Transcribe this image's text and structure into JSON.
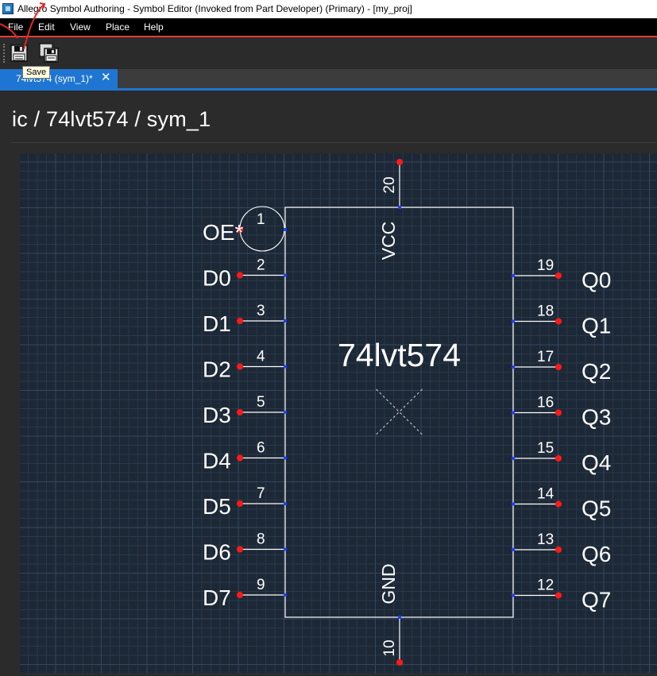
{
  "window": {
    "title": "Allegro Symbol Authoring - Symbol Editor (Invoked from Part Developer) (Primary) - [my_proj]"
  },
  "menu": [
    "File",
    "Edit",
    "View",
    "Place",
    "Help"
  ],
  "toolbar": {
    "save_tooltip": "Save",
    "save_icon": "save-icon",
    "save_all_icon": "save-all-icon"
  },
  "tab": {
    "label": "74lvt574 (sym_1)*",
    "close": "✕"
  },
  "breadcrumb": "ic / 74lvt574 / sym_1",
  "symbol": {
    "part_name": "74lvt574",
    "left_pins": [
      {
        "name": "OE*",
        "number": "1",
        "inverted": true
      },
      {
        "name": "D0",
        "number": "2"
      },
      {
        "name": "D1",
        "number": "3"
      },
      {
        "name": "D2",
        "number": "4"
      },
      {
        "name": "D3",
        "number": "5"
      },
      {
        "name": "D4",
        "number": "6"
      },
      {
        "name": "D5",
        "number": "7"
      },
      {
        "name": "D6",
        "number": "8"
      },
      {
        "name": "D7",
        "number": "9"
      }
    ],
    "right_pins": [
      {
        "name": "Q0",
        "number": "19"
      },
      {
        "name": "Q1",
        "number": "18"
      },
      {
        "name": "Q2",
        "number": "17"
      },
      {
        "name": "Q3",
        "number": "16"
      },
      {
        "name": "Q4",
        "number": "15"
      },
      {
        "name": "Q5",
        "number": "14"
      },
      {
        "name": "Q6",
        "number": "13"
      },
      {
        "name": "Q7",
        "number": "12"
      }
    ],
    "top_pin": {
      "name": "VCC",
      "number": "20"
    },
    "bottom_pin": {
      "name": "GND",
      "number": "10"
    },
    "colors": {
      "body": "#ffffff",
      "pin_end": "#ff1a1a",
      "pin_connection": "#1f3dff",
      "origin_marker": "#d8d8d8"
    }
  }
}
